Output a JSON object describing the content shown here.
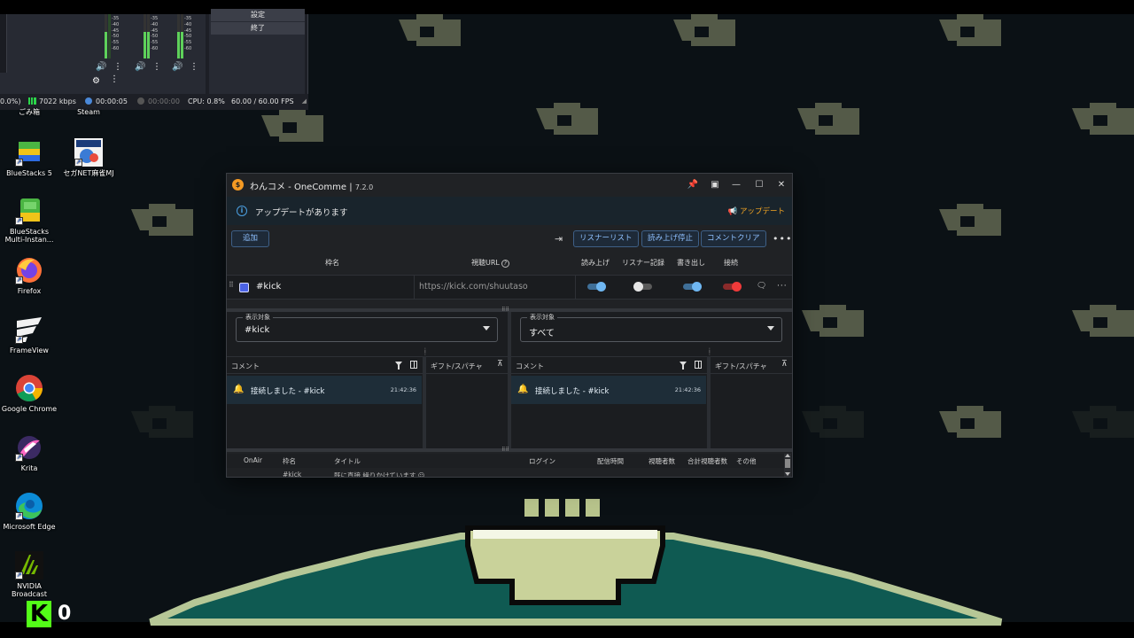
{
  "obs": {
    "meter_scale": [
      "-35",
      "-40",
      "-45",
      "-50",
      "-55",
      "-60"
    ],
    "control_button": "終了",
    "top_button": "設定",
    "status": {
      "dropped": "0.0%)",
      "bitrate": "7022 kbps",
      "stream_time": "00:00:05",
      "rec_time": "00:00:00",
      "cpu": "CPU: 0.8%",
      "fps": "60.00 / 60.00 FPS"
    }
  },
  "desktop": {
    "top_labels": [
      "ごみ箱",
      "Steam"
    ],
    "icons": [
      {
        "label": "BlueStacks 5",
        "icon": "bluestacks-icon"
      },
      {
        "label": "セガNET麻雀MJ",
        "icon": "mj-icon"
      },
      {
        "label": "BlueStacks Multi-Instan...",
        "icon": "bluestacks-multi-icon"
      },
      {
        "label": "Firefox",
        "icon": "firefox-icon"
      },
      {
        "label": "FrameView",
        "icon": "frameview-icon"
      },
      {
        "label": "Google Chrome",
        "icon": "chrome-icon"
      },
      {
        "label": "Krita",
        "icon": "krita-icon"
      },
      {
        "label": "Microsoft Edge",
        "icon": "edge-icon"
      },
      {
        "label": "NVIDIA Broadcast",
        "icon": "nvidia-broadcast-icon"
      }
    ]
  },
  "app": {
    "title": "わんコメ - OneComme |",
    "version": "7.2.0",
    "update_notice": "アップデートがあります",
    "update_link": "アップデート",
    "toolbar": {
      "add": "追加",
      "listener_list": "リスナーリスト",
      "stop_reading": "読み上げ停止",
      "clear_comments": "コメントクリア"
    },
    "columns": {
      "name": "枠名",
      "url": "視聴URL",
      "read_aloud": "読み上げ",
      "listener_log": "リスナー記録",
      "write_out": "書き出し",
      "connect": "接続"
    },
    "stream": {
      "name": "#kick",
      "url": "https://kick.com/shuutaso",
      "color": "#4b63e6",
      "read_aloud_on": true,
      "listener_log_on": false,
      "write_out_on": true,
      "connected": true
    },
    "panels": [
      {
        "select_label": "表示対象",
        "select_value": "#kick",
        "comment_header": "コメント",
        "gift_header": "ギフト/スパチャ",
        "comment": "接続しました - #kick",
        "time": "21:42:36"
      },
      {
        "select_label": "表示対象",
        "select_value": "すべて",
        "comment_header": "コメント",
        "gift_header": "ギフト/スパチャ",
        "comment": "接続しました - #kick",
        "time": "21:42:36"
      }
    ],
    "table": {
      "headers": [
        "OnAir",
        "枠名",
        "タイトル",
        "ログイン",
        "配信時間",
        "視聴者数",
        "合計視聴者数",
        "その他"
      ],
      "row": {
        "name": "#kick",
        "title": "既に直接 繰りかけています ☺"
      }
    }
  },
  "kick_widget": {
    "logo": "K",
    "count": "0"
  },
  "colors": {
    "accent_blue": "#8ec0ff",
    "update_orange": "#f5a623",
    "connect_red": "#f03a3a",
    "kick_green": "#53fc18"
  }
}
